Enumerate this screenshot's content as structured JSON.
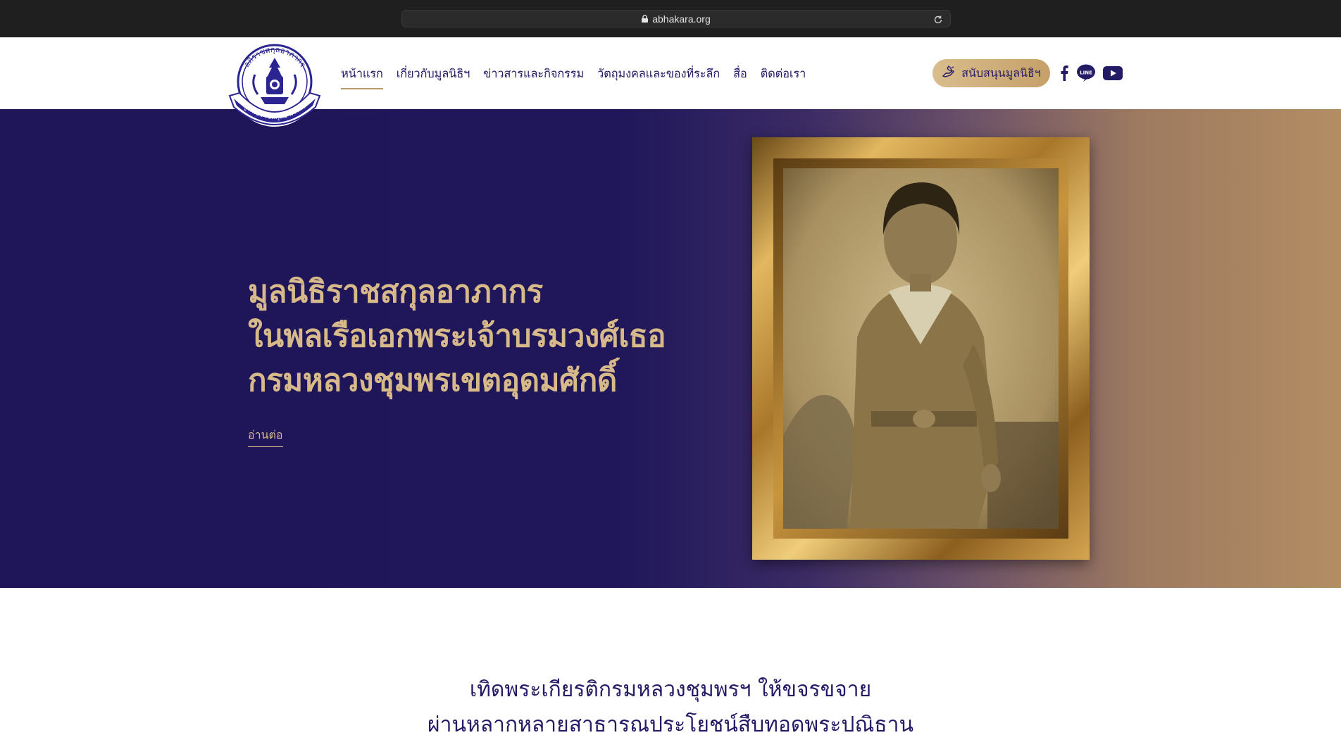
{
  "browser": {
    "url": "abhakara.org"
  },
  "logo": {
    "text_top": "อภิราชสกุลอาภากร",
    "text_ribbon": "มูลนิธิราชสกุลอาภากร",
    "colors": {
      "primary": "#2c2591",
      "ring": "#ffffff"
    }
  },
  "nav": {
    "items": [
      {
        "label": "หน้าแรก",
        "active": true
      },
      {
        "label": "เกี่ยวกับมูลนิธิฯ",
        "active": false
      },
      {
        "label": "ข่าวสารและกิจกรรม",
        "active": false
      },
      {
        "label": "วัตถุมงคลและของที่ระลึก",
        "active": false
      },
      {
        "label": "สื่อ",
        "active": false
      },
      {
        "label": "ติดต่อเรา",
        "active": false
      }
    ]
  },
  "donate": {
    "label": "สนับสนุนมูลนิธิฯ",
    "icon": "donate-hand-icon"
  },
  "social": [
    {
      "name": "facebook-icon"
    },
    {
      "name": "line-icon",
      "text": "LINE"
    },
    {
      "name": "youtube-icon"
    }
  ],
  "hero": {
    "title_lines": [
      "มูลนิธิราชสกุลอาภากร",
      "ในพลเรือเอกพระเจ้าบรมวงศ์เธอ",
      "กรมหลวงชุมพรเขตอุดมศักดิ์"
    ],
    "read_more": "อ่านต่อ",
    "colors": {
      "title": "#d7b98a",
      "bg_left": "#1e1658",
      "bg_right": "#b38d63"
    }
  },
  "mission": {
    "lines": [
      "เทิดพระเกียรติกรมหลวงชุมพรฯ ให้ขจรขจาย",
      "ผ่านหลากหลายสาธารณประโยชน์สืบทอดพระปณิธาน"
    ]
  }
}
